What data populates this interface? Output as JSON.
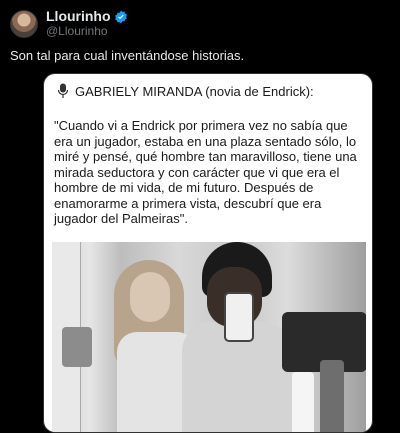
{
  "author": {
    "display_name": "Llourinho",
    "handle": "@Llourinho",
    "verified_color": "#1d9bf0"
  },
  "tweet": {
    "text": "Son tal para cual inventándose historias."
  },
  "media": {
    "title": "GABRIELY MIRANDA (novia de Endrick):",
    "title_icon": "microphone-icon",
    "quote": "\"Cuando vi a Endrick por primera vez no sabía que era un jugador, estaba en una plaza sentado sólo, lo miré y pensé, qué hombre tan maravilloso, tiene una mirada seductora y con carácter que vi que era el hombre de mi vida, de mi futuro. Después de enamorarme a primera vista, descubrí que era jugador del Palmeiras\"."
  }
}
